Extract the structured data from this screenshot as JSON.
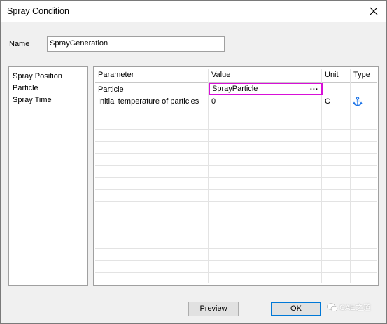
{
  "window": {
    "title": "Spray Condition"
  },
  "name_field": {
    "label": "Name",
    "value": "SprayGeneration"
  },
  "left_list": {
    "items": [
      "Spray Position",
      "Particle",
      "Spray Time"
    ]
  },
  "table": {
    "columns": [
      "Parameter",
      "Value",
      "Unit",
      "Type"
    ],
    "rows": [
      {
        "parameter": "Particle",
        "value": "SprayParticle",
        "unit": "",
        "type": "",
        "browse": "..."
      },
      {
        "parameter": "Initial temperature of particles",
        "value": "0",
        "unit": "C",
        "type_icon": "anchor-icon"
      }
    ]
  },
  "buttons": {
    "preview": "Preview",
    "ok": "OK"
  },
  "watermark": {
    "text": "CAE之道"
  },
  "colors": {
    "editor_border": "#d80fd8",
    "icon_blue": "#1a73e8",
    "ok_border": "#0078d7"
  }
}
